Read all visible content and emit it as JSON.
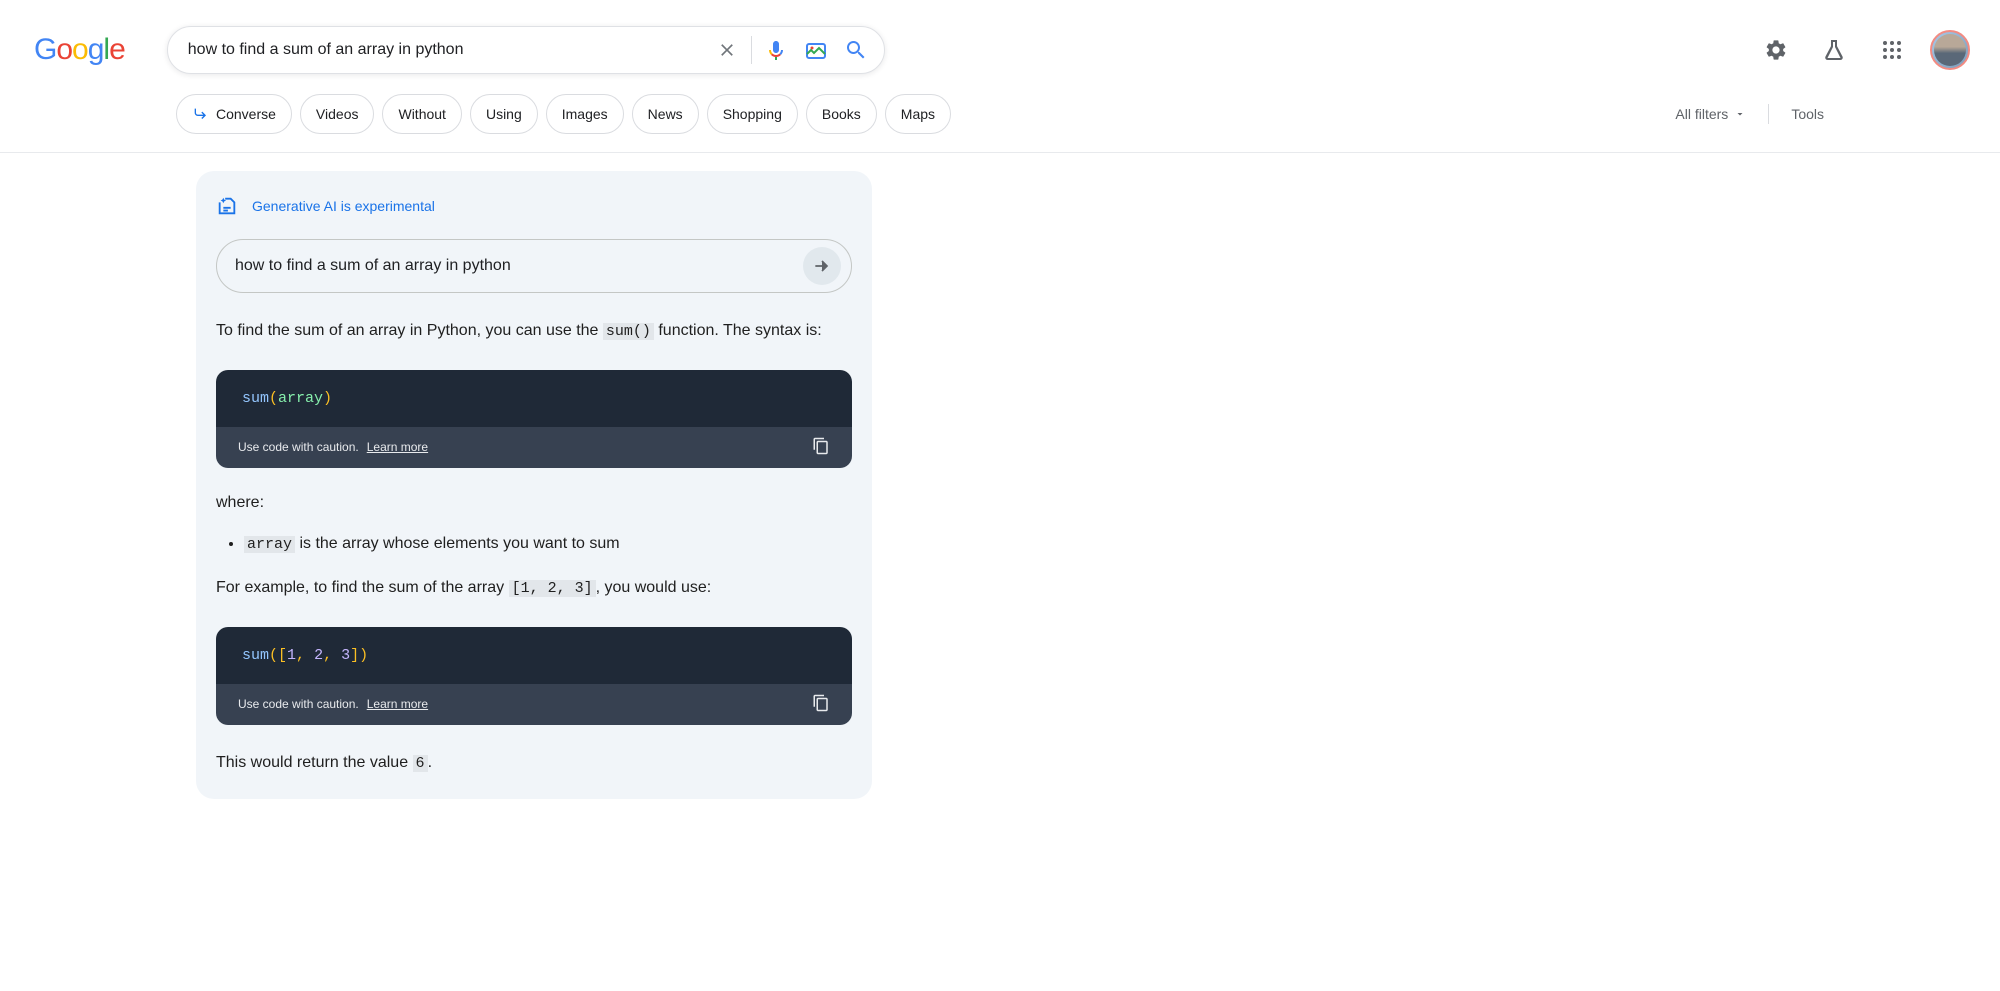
{
  "logo": {
    "letters": [
      "G",
      "o",
      "o",
      "g",
      "l",
      "e"
    ]
  },
  "search": {
    "query": "how to find a sum of an array in python"
  },
  "tabs": {
    "converse": "Converse",
    "items": [
      "Videos",
      "Without",
      "Using",
      "Images",
      "News",
      "Shopping",
      "Books",
      "Maps"
    ],
    "all_filters": "All filters",
    "tools": "Tools"
  },
  "ai": {
    "header": "Generative AI is experimental",
    "input_value": "how to find a sum of an array in python",
    "text_p1_a": "To find the sum of an array in Python, you can use the ",
    "text_p1_code": "sum()",
    "text_p1_b": " function. The syntax is:",
    "code1": {
      "kw": "sum",
      "open": "(",
      "var": "array",
      "close": ")"
    },
    "code_caution": "Use code with caution.",
    "learn_more": "Learn more",
    "where": "where:",
    "bullet_code": "array",
    "bullet_text": " is the array whose elements you want to sum",
    "example_a": "For example, to find the sum of the array ",
    "example_code": "[1, 2, 3]",
    "example_b": ", you would use:",
    "code2": {
      "kw": "sum",
      "open": "([",
      "n1": "1",
      "c1": ", ",
      "n2": "2",
      "c2": ", ",
      "n3": "3",
      "close": "])"
    },
    "return_a": "This would return the value ",
    "return_code": "6",
    "return_b": "."
  }
}
